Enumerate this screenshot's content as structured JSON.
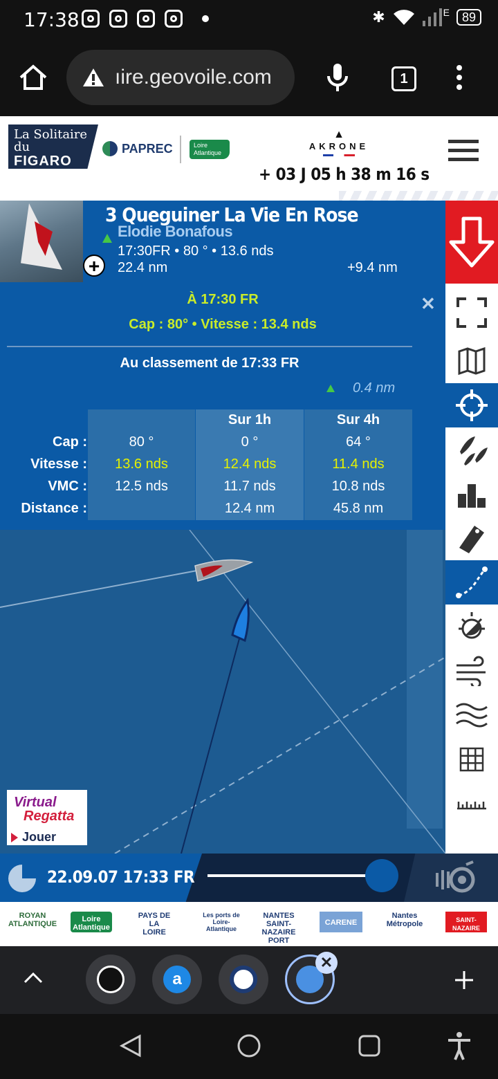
{
  "status_bar": {
    "time": "17:38",
    "network_label": "E",
    "battery": "89"
  },
  "browser": {
    "url": "ıire.geovoile.com",
    "tab_count": "1"
  },
  "header": {
    "logo_line1": "La Solitaire du",
    "logo_line2": "FIGARO",
    "sponsor1": "PAPREC",
    "sponsor2": "Loire Atlantique",
    "sponsor3": "AKRONE",
    "countdown": "+ 03 J 05 h 38 m 16 s"
  },
  "boat": {
    "rank_name": "3 Queguiner La Vie En Rose",
    "skipper": "Elodie Bonafous",
    "line1": "17:30FR • 80 ° • 13.6 nds",
    "line2": "22.4 nm",
    "gap": "+9.4 nm"
  },
  "detail": {
    "at_time": "À  17:30 FR",
    "cap_vitesse": "Cap : 80° • Vitesse : 13.4 nds",
    "classement": "Au classement de  17:33 FR",
    "gap_nm": "0.4 nm",
    "col_headers": [
      "",
      "Sur 1h",
      "Sur 4h"
    ],
    "rows": [
      {
        "label": "Cap :",
        "now": "80 °",
        "h1": "0 °",
        "h4": "64 °"
      },
      {
        "label": "Vitesse :",
        "now": "13.6 nds",
        "h1": "12.4 nds",
        "h4": "11.4 nds"
      },
      {
        "label": "VMC :",
        "now": "12.5 nds",
        "h1": "11.7 nds",
        "h4": "10.8 nds"
      },
      {
        "label": "Distance :",
        "now": "",
        "h1": "12.4 nm",
        "h4": "45.8 nm"
      }
    ]
  },
  "virtual_regatta": {
    "line1": "Virtual",
    "line2": "Regatta",
    "play": "Jouer"
  },
  "timeline": {
    "datetime": "22.09.07 17:33 FR"
  },
  "partners": [
    "ROYAN ATLANTIQUE",
    "Loire Atlantique",
    "PAYS DE LA LOIRE",
    "Les ports de Loire-Atlantique",
    "NANTES SAINT-NAZAIRE PORT",
    "CARENE",
    "Nantes Métropole",
    "SAINT-NAZAIRE"
  ],
  "colors": {
    "panel_blue": "#0b5aa6",
    "highlight_yellow": "#e6f200",
    "gain_green": "#46c846",
    "alert_red": "#e11b22"
  }
}
